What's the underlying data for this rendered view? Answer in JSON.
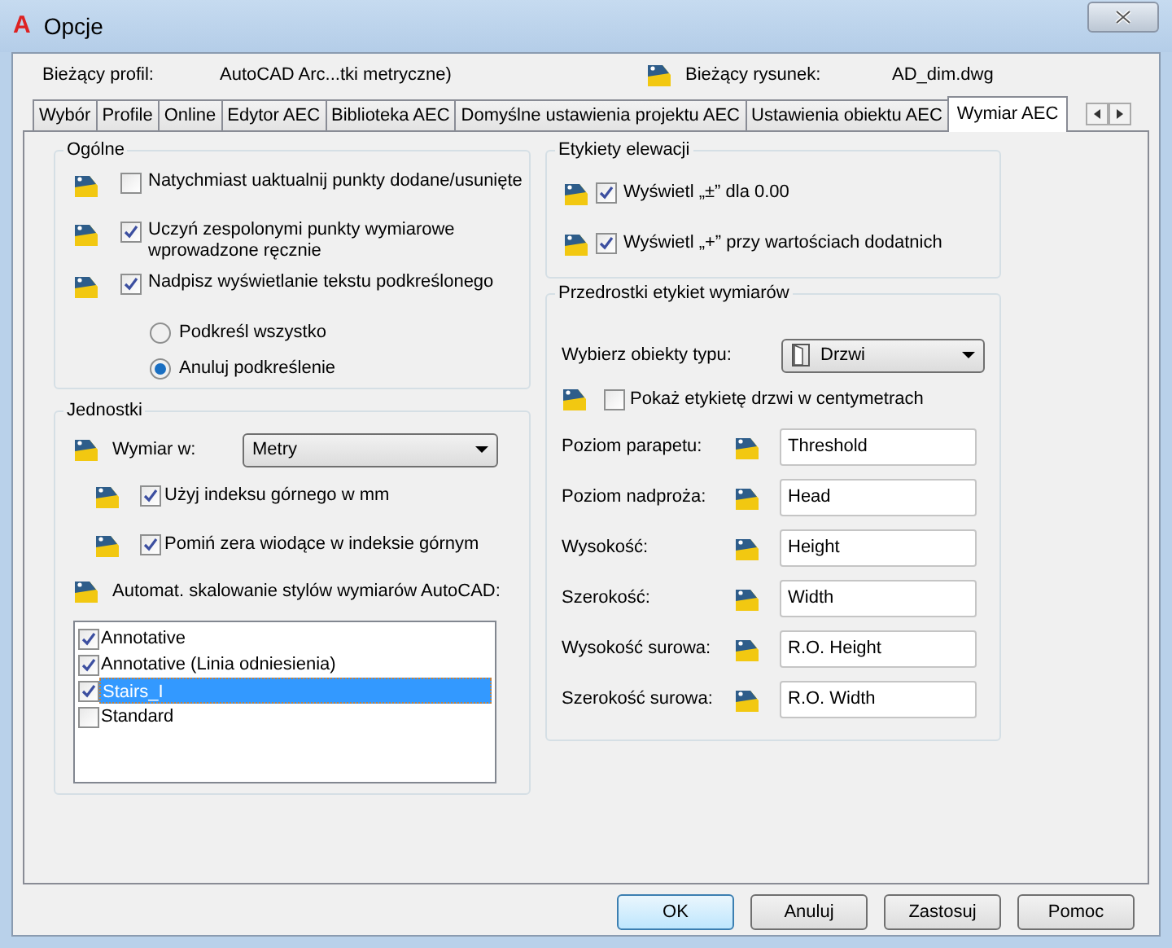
{
  "window": {
    "logo": "A",
    "title": "Opcje"
  },
  "profile": {
    "label": "Bieżący profil:",
    "value": "AutoCAD Arc...tki metryczne)"
  },
  "drawing": {
    "label": "Bieżący rysunek:",
    "value": "AD_dim.dwg"
  },
  "tabs": [
    {
      "label": "Wybór",
      "selected": false
    },
    {
      "label": "Profile",
      "selected": false
    },
    {
      "label": "Online",
      "selected": false
    },
    {
      "label": "Edytor AEC",
      "selected": false
    },
    {
      "label": "Biblioteka AEC",
      "selected": false
    },
    {
      "label": "Domyślne ustawienia projektu AEC",
      "selected": false
    },
    {
      "label": "Ustawienia obiektu AEC",
      "selected": false
    },
    {
      "label": "Wymiar AEC",
      "selected": true
    }
  ],
  "general": {
    "title": "Ogólne",
    "items": [
      {
        "kind": "checkbox",
        "label": "Natychmiast uaktualnij punkty dodane/usunięte",
        "checked": false
      },
      {
        "kind": "checkbox",
        "label": "Uczyń zespolonymi punkty wymiarowe wprowadzone ręcznie",
        "checked": true
      },
      {
        "kind": "checkbox",
        "label": "Nadpisz wyświetlanie tekstu podkreślonego",
        "checked": true
      },
      {
        "kind": "radio",
        "label": "Podkreśl wszystko",
        "selected": false
      },
      {
        "kind": "radio",
        "label": "Anuluj podkreślenie",
        "selected": true
      }
    ]
  },
  "units": {
    "title": "Jednostki",
    "dimension_label": "Wymiar w:",
    "dimension_value": "Metry",
    "options": [
      {
        "label": "Użyj indeksu górnego w mm",
        "checked": true
      },
      {
        "label": "Pomiń zera wiodące w indeksie górnym",
        "checked": true
      }
    ],
    "scaling_label": "Automat. skalowanie stylów wymiarów AutoCAD:",
    "styles": [
      {
        "label": "Annotative",
        "checked": true,
        "selected": false
      },
      {
        "label": "Annotative (Linia odniesienia)",
        "checked": true,
        "selected": false
      },
      {
        "label": "Stairs_I",
        "checked": true,
        "selected": true
      },
      {
        "label": "Standard",
        "checked": false,
        "selected": false
      }
    ]
  },
  "elevation": {
    "title": "Etykiety elewacji",
    "items": [
      {
        "label": "Wyświetl „±” dla 0.00",
        "checked": true
      },
      {
        "label": "Wyświetl „+” przy wartościach dodatnich",
        "checked": true
      }
    ]
  },
  "prefixes": {
    "title": "Przedrostki etykiet wymiarów",
    "object_label": "Wybierz obiekty typu:",
    "object_value": "Drzwi",
    "centimeters": {
      "label": "Pokaż etykietę drzwi w centymetrach",
      "checked": false
    },
    "fields": [
      {
        "label": "Poziom parapetu:",
        "value": "Threshold"
      },
      {
        "label": "Poziom nadproża:",
        "value": "Head"
      },
      {
        "label": "Wysokość:",
        "value": "Height"
      },
      {
        "label": "Szerokość:",
        "value": "Width"
      },
      {
        "label": "Wysokość surowa:",
        "value": "R.O. Height"
      },
      {
        "label": "Szerokość surowa:",
        "value": "R.O. Width"
      }
    ]
  },
  "buttons": [
    {
      "label": "OK",
      "default": true
    },
    {
      "label": "Anuluj",
      "default": false
    },
    {
      "label": "Zastosuj",
      "default": false
    },
    {
      "label": "Pomoc",
      "default": false
    }
  ]
}
